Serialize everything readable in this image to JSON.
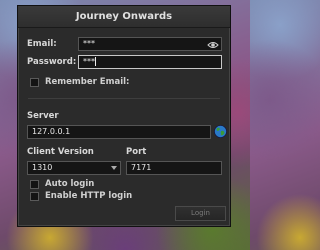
{
  "window": {
    "title": "Journey Onwards"
  },
  "login": {
    "email_label": "Email:",
    "email_value": "***",
    "password_label": "Password:",
    "password_value": "***",
    "remember_label": "Remember Email:"
  },
  "server": {
    "server_label": "Server",
    "server_value": "127.0.0.1",
    "client_version_label": "Client Version",
    "client_version_value": "1310",
    "port_label": "Port",
    "port_value": "7171",
    "auto_login_label": "Auto login",
    "http_login_label": "Enable HTTP login"
  },
  "actions": {
    "login_label": "Login"
  },
  "icons": {
    "show_password": "eye-icon",
    "server_globe": "globe-icon",
    "version_dropdown": "chevron-down-icon"
  },
  "colors": {
    "window_bg": "#2b2b2b",
    "field_bg": "#151515",
    "globe_blue": "#2a7ac8",
    "globe_green": "#3a9a3a"
  }
}
